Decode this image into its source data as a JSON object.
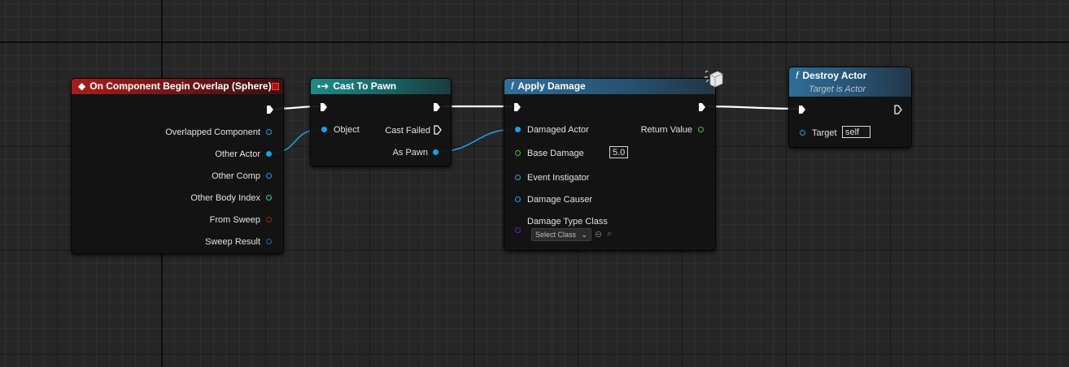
{
  "nodes": {
    "begin_overlap": {
      "title": "On Component Begin Overlap (Sphere)",
      "outputs": {
        "overlapped_component": "Overlapped Component",
        "other_actor": "Other Actor",
        "other_comp": "Other Comp",
        "other_body_index": "Other Body Index",
        "from_sweep": "From Sweep",
        "sweep_result": "Sweep Result"
      }
    },
    "cast_to_pawn": {
      "title": "Cast To Pawn",
      "inputs": {
        "object": "Object"
      },
      "outputs": {
        "cast_failed": "Cast Failed",
        "as_pawn": "As Pawn"
      }
    },
    "apply_damage": {
      "title": "Apply Damage",
      "inputs": {
        "damaged_actor": "Damaged Actor",
        "base_damage": "Base Damage",
        "base_damage_value": "5.0",
        "event_instigator": "Event Instigator",
        "damage_causer": "Damage Causer",
        "damage_type_class": "Damage Type Class",
        "damage_type_select": "Select Class"
      },
      "outputs": {
        "return_value": "Return Value"
      }
    },
    "destroy_actor": {
      "title": "Destroy Actor",
      "subtitle": "Target is Actor",
      "inputs": {
        "target": "Target",
        "target_value": "self"
      }
    }
  },
  "pin_colors": {
    "exec": "#ffffff",
    "object": "#1aa0e8",
    "float": "#3cc23c",
    "int": "#28d49a",
    "bool": "#a01c1c",
    "struct": "#0e6ad4",
    "class": "#6a1fb0"
  },
  "header_colors": {
    "event": "#a81d1d",
    "cast": "#1e8a8a",
    "function": "#2f6e98"
  }
}
